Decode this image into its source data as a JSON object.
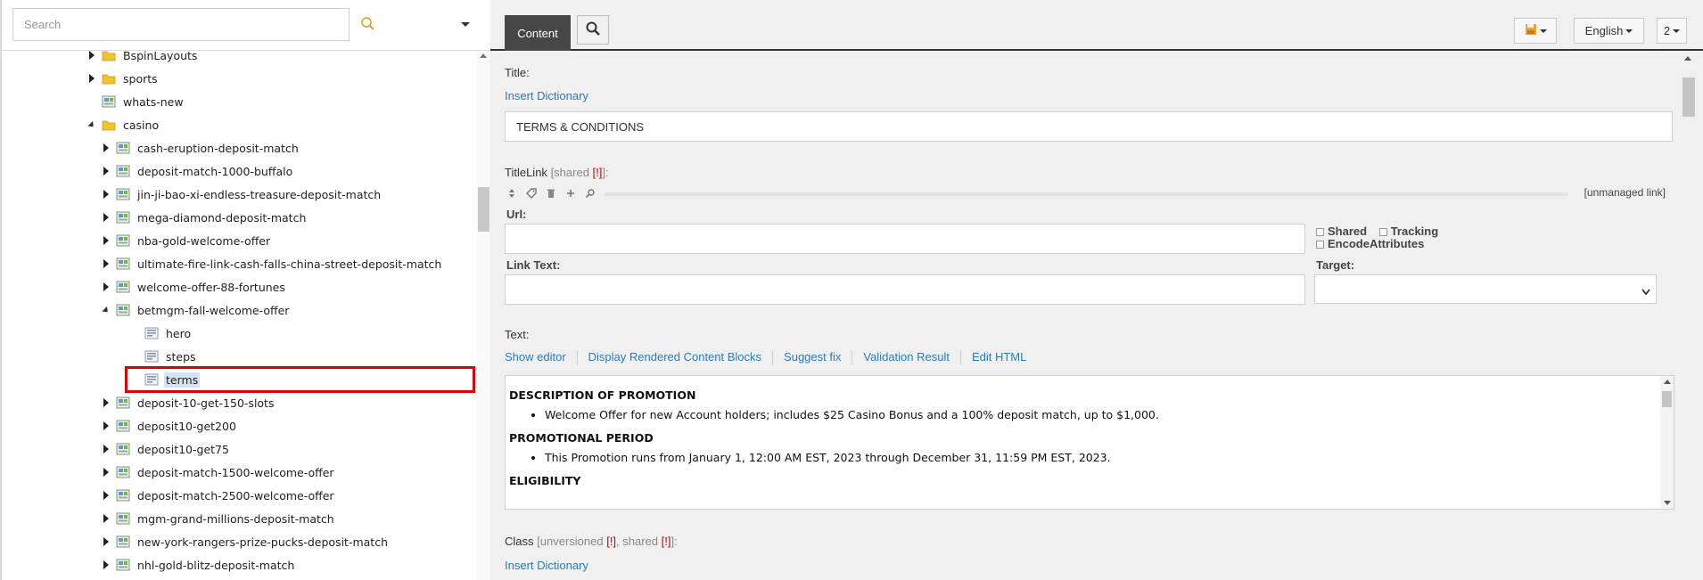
{
  "sidebar": {
    "search_placeholder": "Search",
    "tree": [
      {
        "label": "BspinLayouts",
        "icon": "folder-icon",
        "toggle": "collapsed",
        "depth": 0
      },
      {
        "label": "sports",
        "icon": "folder-icon",
        "toggle": "collapsed",
        "depth": 0
      },
      {
        "label": "whats-new",
        "icon": "page-icon",
        "toggle": "none",
        "depth": 0
      },
      {
        "label": "casino",
        "icon": "folder-icon",
        "toggle": "expanded",
        "depth": 0
      },
      {
        "label": "cash-eruption-deposit-match",
        "icon": "page-icon",
        "toggle": "collapsed",
        "depth": 1
      },
      {
        "label": "deposit-match-1000-buffalo",
        "icon": "page-icon",
        "toggle": "collapsed",
        "depth": 1
      },
      {
        "label": "jin-ji-bao-xi-endless-treasure-deposit-match",
        "icon": "page-icon",
        "toggle": "collapsed",
        "depth": 1
      },
      {
        "label": "mega-diamond-deposit-match",
        "icon": "page-icon",
        "toggle": "collapsed",
        "depth": 1
      },
      {
        "label": "nba-gold-welcome-offer",
        "icon": "page-icon",
        "toggle": "collapsed",
        "depth": 1
      },
      {
        "label": "ultimate-fire-link-cash-falls-china-street-deposit-match",
        "icon": "page-icon",
        "toggle": "collapsed",
        "depth": 1
      },
      {
        "label": "welcome-offer-88-fortunes",
        "icon": "page-icon",
        "toggle": "collapsed",
        "depth": 1
      },
      {
        "label": "betmgm-fall-welcome-offer",
        "icon": "page-icon",
        "toggle": "expanded",
        "depth": 1
      },
      {
        "label": "hero",
        "icon": "component-icon",
        "toggle": "none",
        "depth": 2
      },
      {
        "label": "steps",
        "icon": "component-icon",
        "toggle": "none",
        "depth": 2
      },
      {
        "label": "terms",
        "icon": "component-icon",
        "toggle": "none",
        "depth": 2,
        "selected": true
      },
      {
        "label": "deposit-10-get-150-slots",
        "icon": "page-icon",
        "toggle": "collapsed",
        "depth": 1
      },
      {
        "label": "deposit10-get200",
        "icon": "page-icon",
        "toggle": "collapsed",
        "depth": 1
      },
      {
        "label": "deposit10-get75",
        "icon": "page-icon",
        "toggle": "collapsed",
        "depth": 1
      },
      {
        "label": "deposit-match-1500-welcome-offer",
        "icon": "page-icon",
        "toggle": "collapsed",
        "depth": 1
      },
      {
        "label": "deposit-match-2500-welcome-offer",
        "icon": "page-icon",
        "toggle": "collapsed",
        "depth": 1
      },
      {
        "label": "mgm-grand-millions-deposit-match",
        "icon": "page-icon",
        "toggle": "collapsed",
        "depth": 1
      },
      {
        "label": "new-york-rangers-prize-pucks-deposit-match",
        "icon": "page-icon",
        "toggle": "collapsed",
        "depth": 1
      },
      {
        "label": "nhl-gold-blitz-deposit-match",
        "icon": "page-icon",
        "toggle": "collapsed",
        "depth": 1
      }
    ]
  },
  "toolbar": {
    "content_tab": "Content",
    "language": "English",
    "version": "2"
  },
  "editor": {
    "title_label": "Title:",
    "insert_dictionary": "Insert Dictionary",
    "title_value": "TERMS & CONDITIONS",
    "titlelink_label": "TitleLink",
    "shared_note_open": "[shared ",
    "flag": "[!]",
    "shared_note_close": "]:",
    "unmanaged_link": "[unmanaged link]",
    "url_label": "Url:",
    "shared_label": "Shared",
    "tracking_label": "Tracking",
    "encode_label": "EncodeAttributes",
    "link_text_label": "Link Text:",
    "target_label": "Target:",
    "text_label": "Text:",
    "text_actions": [
      "Show editor",
      "Display Rendered Content Blocks",
      "Suggest fix",
      "Validation Result",
      "Edit HTML"
    ],
    "rte": {
      "h1": "DESCRIPTION OF PROMOTION",
      "p1": "Welcome Offer for new Account holders; includes $25 Casino Bonus and a 100% deposit match, up to $1,000.",
      "h2": "PROMOTIONAL PERIOD",
      "p2": "This Promotion runs from January 1, 12:00 AM EST, 2023 through December 31, 11:59 PM EST, 2023.",
      "h3": "ELIGIBILITY"
    },
    "class_label": "Class",
    "class_note_open": "[unversioned ",
    "class_note_mid": ", shared ",
    "class_note_close": "]:",
    "insert_dictionary_2": "Insert Dictionary"
  },
  "colors": {
    "accent_link": "#2b7bb9",
    "selection_highlight": "#e00000",
    "active_tab": "#474747",
    "warning_flag": "#cc0000"
  }
}
